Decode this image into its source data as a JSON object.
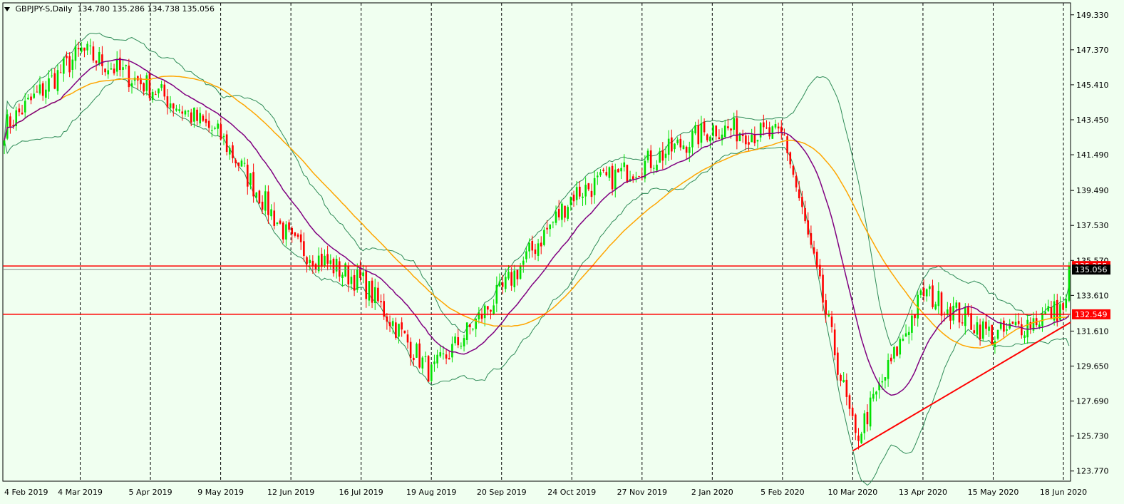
{
  "header": {
    "symbol": "GBPJPY-S,Daily",
    "ohlc": "134.780 135.286 134.738 135.056"
  },
  "colors": {
    "background": "#f0fff0",
    "bull_candle": "#00e000",
    "bear_candle": "#ff0000",
    "ma_fast": "#800080",
    "ma_slow": "#ffa500",
    "bollinger": "#2e8b57",
    "levels": "#ff0000",
    "trendline": "#ff0000",
    "price_line": "#808080"
  },
  "chart_data": {
    "type": "candlestick",
    "symbol": "GBPJPY-S",
    "timeframe": "Daily",
    "last_ohlc": {
      "open": 134.78,
      "high": 135.286,
      "low": 134.738,
      "close": 135.056
    },
    "y_ticks": [
      "149.330",
      "147.370",
      "145.410",
      "143.450",
      "141.490",
      "139.490",
      "137.530",
      "135.570",
      "133.610",
      "131.610",
      "129.650",
      "127.690",
      "125.730",
      "123.770"
    ],
    "ylim": [
      123.2,
      150.0
    ],
    "x_labels": [
      "4 Feb 2019",
      "4 Mar 2019",
      "5 Apr 2019",
      "9 May 2019",
      "12 Jun 2019",
      "16 Jul 2019",
      "19 Aug 2019",
      "20 Sep 2019",
      "24 Oct 2019",
      "27 Nov 2019",
      "2 Jan 2020",
      "5 Feb 2020",
      "10 Mar 2020",
      "13 Apr 2020",
      "15 May 2020",
      "18 Jun 2020"
    ],
    "horizontal_levels": [
      {
        "label": "135.255",
        "value": 135.255
      },
      {
        "label": "132.549",
        "value": 132.549
      }
    ],
    "current_price_label": "135.056",
    "trendline": {
      "from": {
        "date": "10 Mar 2020",
        "value": 124.9
      },
      "to": {
        "date": "18 Jun 2020",
        "value": 132.1
      }
    },
    "grid": {
      "vertical_dashed": true,
      "horizontal": false
    },
    "close_anchors": [
      {
        "date": "4 Feb 2019",
        "close": 143.0
      },
      {
        "date": "4 Mar 2019",
        "close": 147.3
      },
      {
        "date": "5 Apr 2019",
        "close": 145.2
      },
      {
        "date": "9 May 2019",
        "close": 142.5
      },
      {
        "date": "12 Jun 2019",
        "close": 136.5
      },
      {
        "date": "16 Jul 2019",
        "close": 134.3
      },
      {
        "date": "19 Aug 2019",
        "close": 129.2
      },
      {
        "date": "20 Sep 2019",
        "close": 133.9
      },
      {
        "date": "24 Oct 2019",
        "close": 139.3
      },
      {
        "date": "27 Nov 2019",
        "close": 141.0
      },
      {
        "date": "2 Jan 2020",
        "close": 143.0
      },
      {
        "date": "5 Feb 2020",
        "close": 142.5
      },
      {
        "date": "10 Mar 2020",
        "close": 125.5
      },
      {
        "date": "13 Apr 2020",
        "close": 133.8
      },
      {
        "date": "15 May 2020",
        "close": 131.3
      },
      {
        "date": "18 Jun 2020",
        "close": 133.0
      }
    ]
  }
}
